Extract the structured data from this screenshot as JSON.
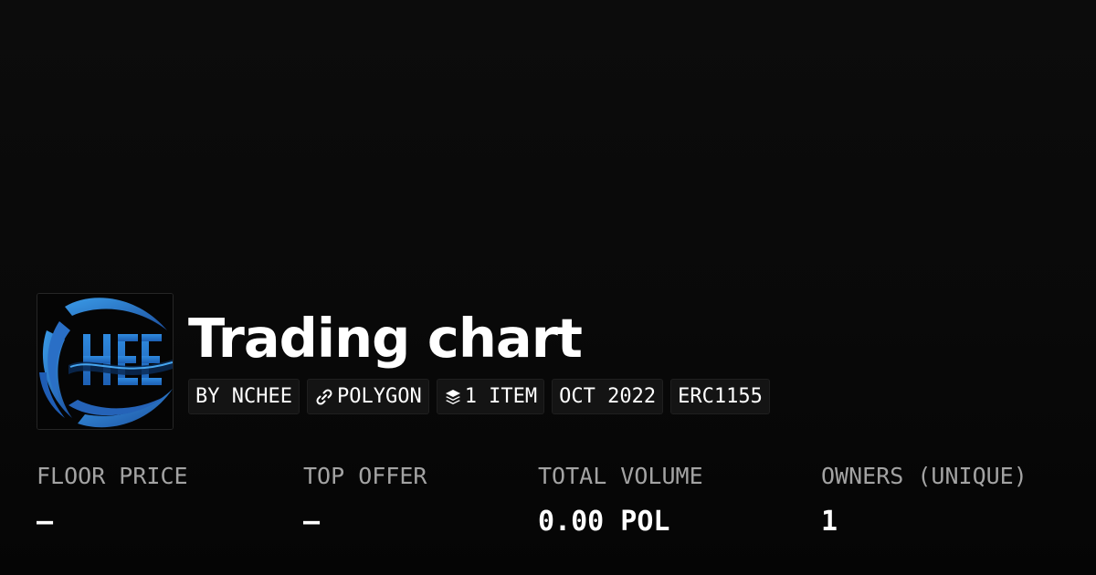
{
  "collection": {
    "title": "Trading chart",
    "logo": {
      "text": "HEE",
      "icon": "nchee-logo",
      "colors": {
        "primary": "#2b7fd6",
        "dark": "#1a4f9c",
        "background": "#050505"
      }
    },
    "tags": [
      {
        "label": "BY NCHEE",
        "icon": ""
      },
      {
        "label": "POLYGON",
        "icon": "chain-link-icon"
      },
      {
        "label": "1 ITEM",
        "icon": "layers-icon"
      },
      {
        "label": "OCT 2022",
        "icon": ""
      },
      {
        "label": "ERC1155",
        "icon": ""
      }
    ]
  },
  "stats": [
    {
      "label": "FLOOR PRICE",
      "value": "–"
    },
    {
      "label": "TOP OFFER",
      "value": "–"
    },
    {
      "label": "TOTAL VOLUME",
      "value": "0.00 POL"
    },
    {
      "label": "OWNERS (UNIQUE)",
      "value": "1"
    }
  ],
  "colors": {
    "background": "#0a0a0a",
    "text": "#ffffff",
    "muted": "#a3a3a3",
    "tag_background": "#141414"
  }
}
